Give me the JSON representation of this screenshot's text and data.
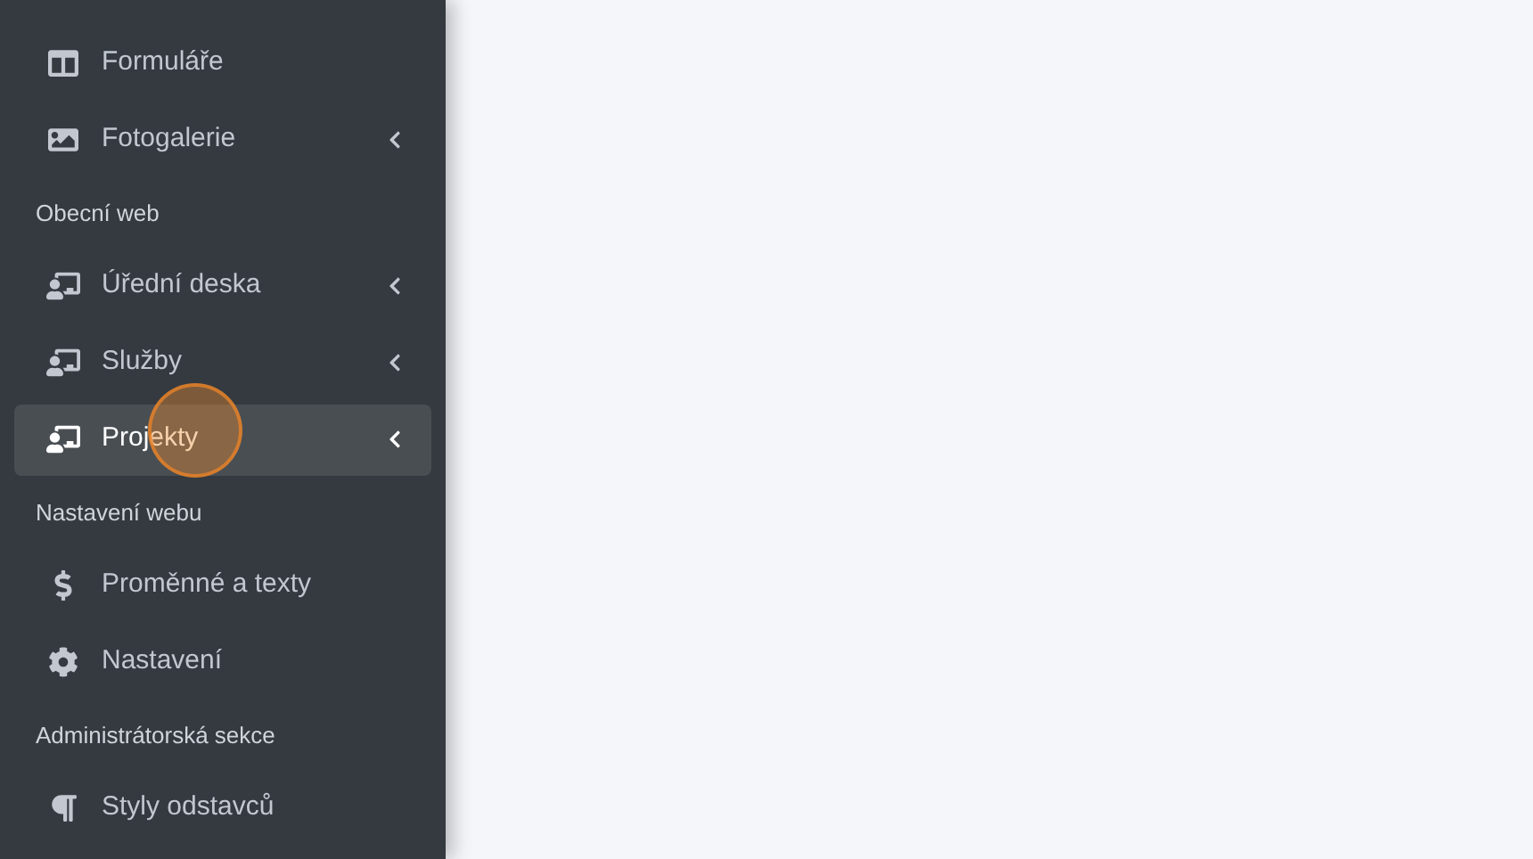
{
  "sidebar": {
    "items": [
      {
        "kind": "item",
        "label": "Formuláře",
        "has_submenu": false,
        "selected": false
      },
      {
        "kind": "item",
        "label": "Fotogalerie",
        "has_submenu": true,
        "selected": false
      },
      {
        "kind": "header",
        "label": "Obecní web"
      },
      {
        "kind": "item",
        "label": "Úřední deska",
        "has_submenu": true,
        "selected": false
      },
      {
        "kind": "item",
        "label": "Služby",
        "has_submenu": true,
        "selected": false
      },
      {
        "kind": "item",
        "label": "Projekty",
        "has_submenu": true,
        "selected": true
      },
      {
        "kind": "header",
        "label": "Nastavení webu"
      },
      {
        "kind": "item",
        "label": "Proměnné a texty",
        "has_submenu": false,
        "selected": false
      },
      {
        "kind": "item",
        "label": "Nastavení",
        "has_submenu": false,
        "selected": false
      },
      {
        "kind": "header",
        "label": "Administrátorská sekce"
      },
      {
        "kind": "item",
        "label": "Styly odstavců",
        "has_submenu": false,
        "selected": false
      }
    ]
  },
  "click_indicator": {
    "shown": true
  }
}
